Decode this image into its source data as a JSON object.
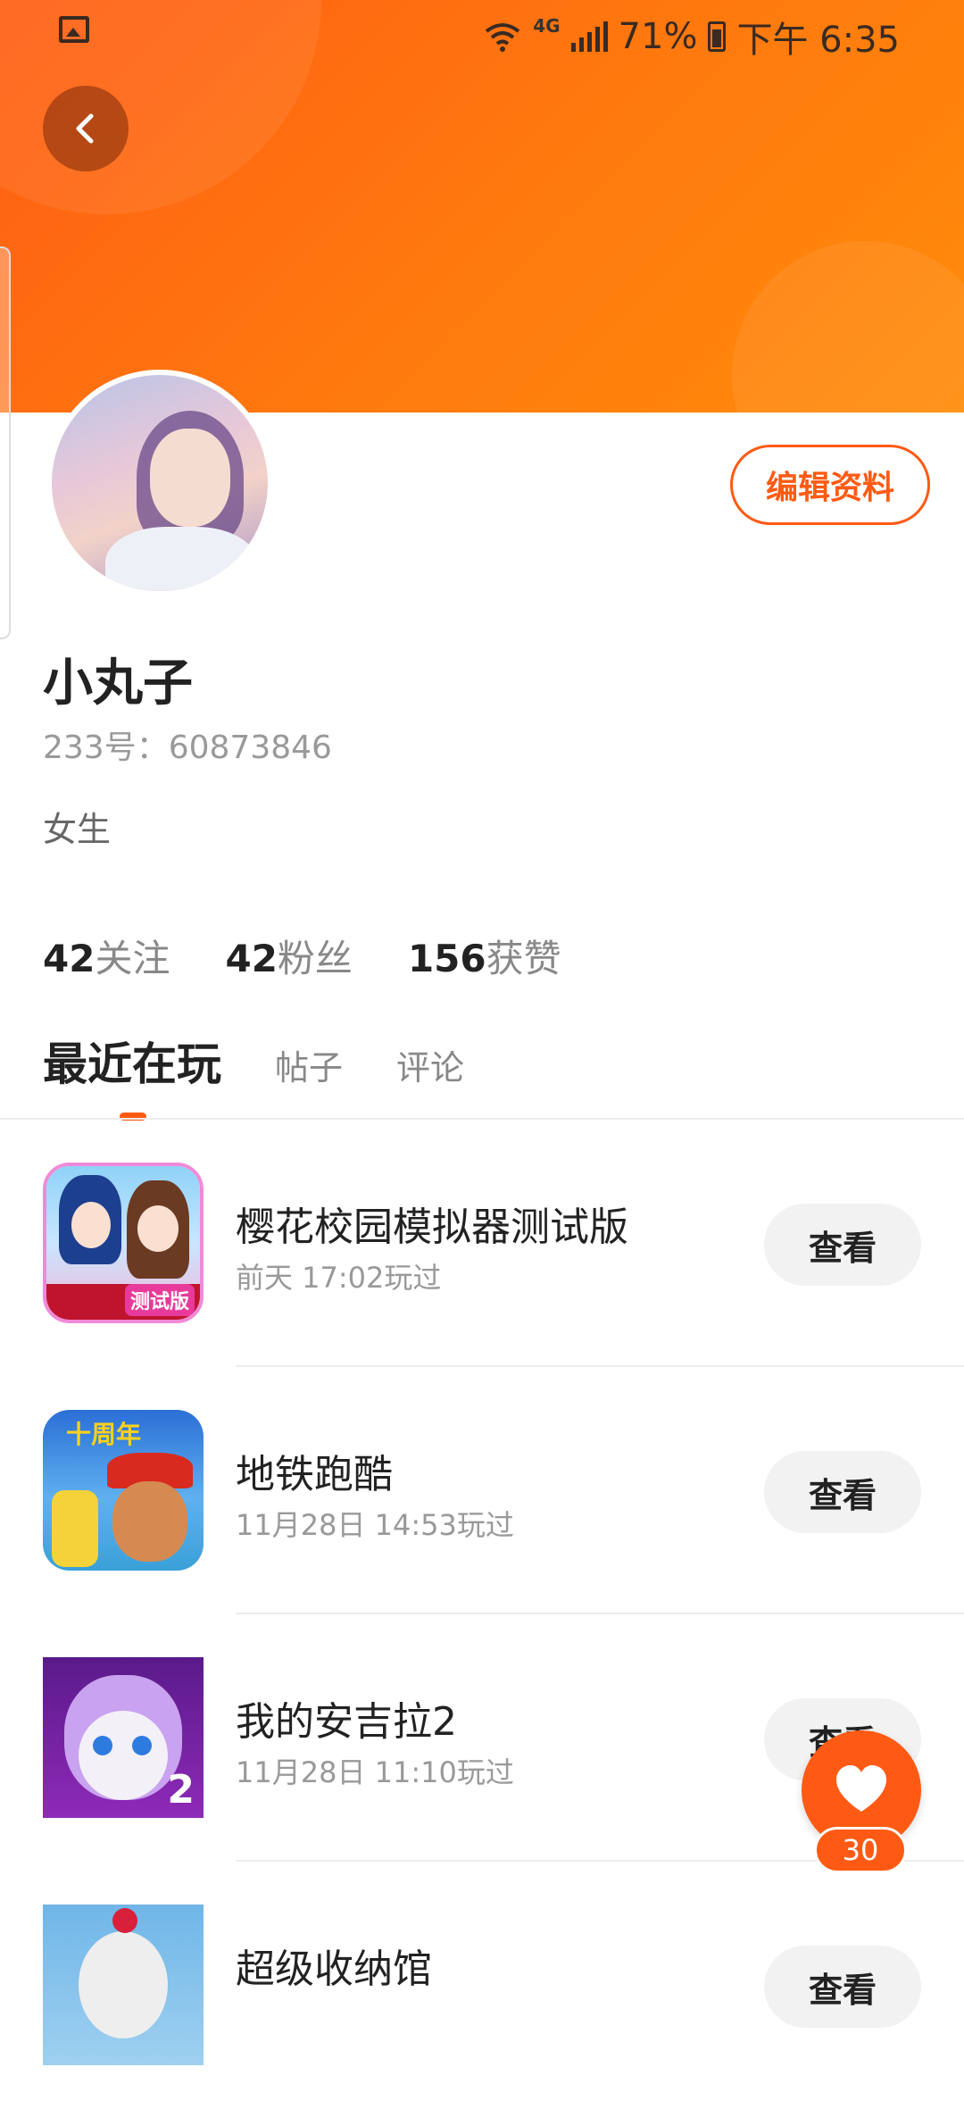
{
  "status_bar": {
    "network": "4G",
    "battery": "71%",
    "time": "下午 6:35"
  },
  "profile": {
    "edit_label": "编辑资料",
    "name": "小丸子",
    "uid": "233号：60873846",
    "gender": "女生",
    "stats": [
      {
        "num": "42",
        "label": "关注"
      },
      {
        "num": "42",
        "label": "粉丝"
      },
      {
        "num": "156",
        "label": "获赞"
      }
    ]
  },
  "tabs": [
    {
      "label": "最近在玩"
    },
    {
      "label": "帖子"
    },
    {
      "label": "评论"
    }
  ],
  "games": [
    {
      "title": "樱花校园模拟器测试版",
      "time": "前天 17:02玩过",
      "button": "查看",
      "icon_badge": "测试版"
    },
    {
      "title": "地铁跑酷",
      "time": "11月28日 14:53玩过",
      "button": "查看",
      "icon_badge": "十周年"
    },
    {
      "title": "我的安吉拉2",
      "time": "11月28日 11:10玩过",
      "button": "查看",
      "icon_badge": "2"
    },
    {
      "title": "超级收纳馆",
      "time": "",
      "button": "查看",
      "icon_badge": ""
    }
  ],
  "like": {
    "count": "30"
  },
  "colors": {
    "accent": "#ff5a14",
    "header_start": "#ff5e14",
    "header_end": "#ff8c0a"
  }
}
